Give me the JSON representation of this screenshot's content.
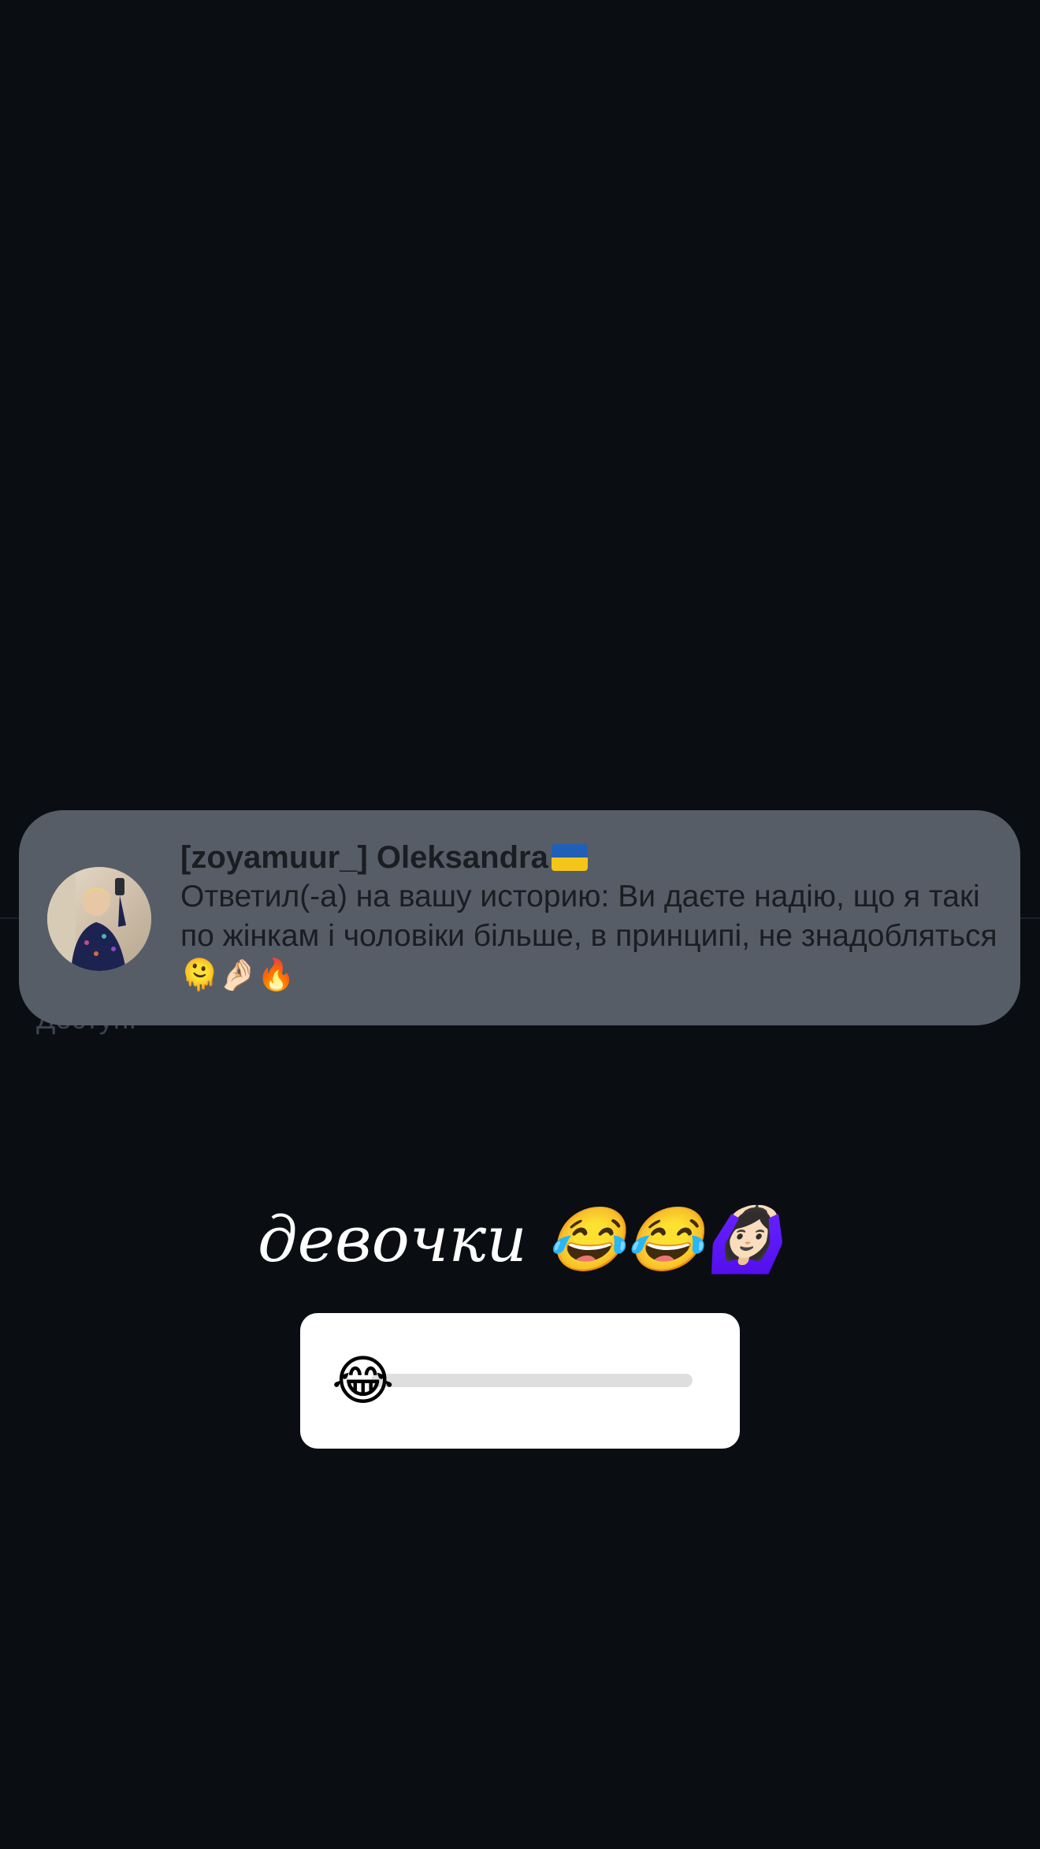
{
  "background_screen": {
    "partial_text": "Доступ."
  },
  "notification": {
    "avatar_icon": "user-avatar-photo",
    "sender": "[zoyamuur_] Oleksandra",
    "flag_icon": "ukraine-flag-icon",
    "message": "Ответил(-а) на вашу историю: Ви даєте надію, що я такі по жінкам і чоловіки більше, в принципі, не знадобляться 🫠🤌🏻🔥"
  },
  "story": {
    "caption": "девочки 😂😂🙆🏻‍♀️",
    "slider_emoji": "😂",
    "slider_value": 0
  }
}
